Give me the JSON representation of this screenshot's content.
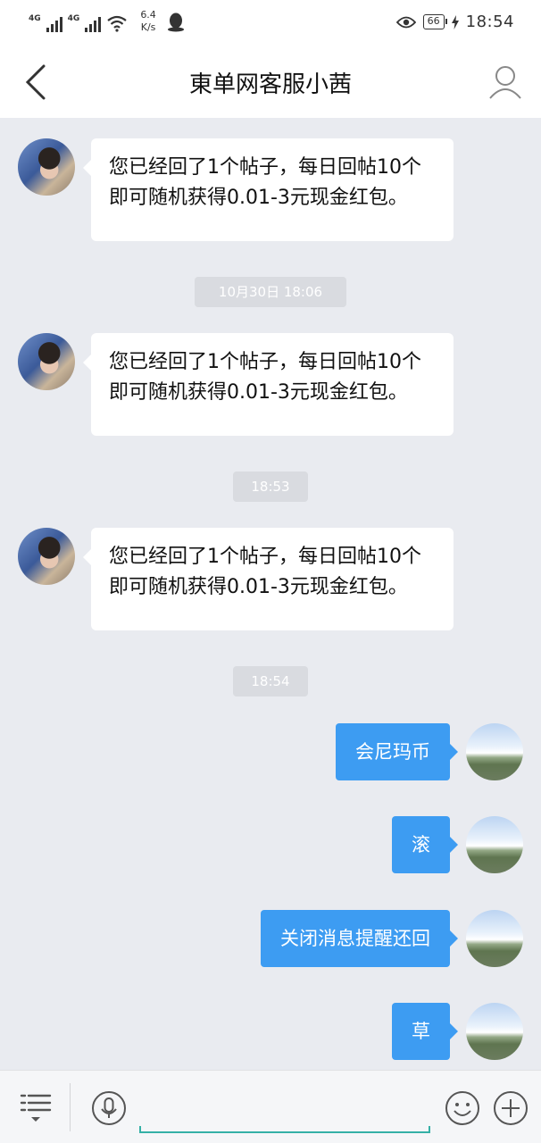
{
  "status_bar": {
    "net1": "4G",
    "net2": "4G",
    "speed_value": "6.4",
    "speed_unit": "K/s",
    "battery": "66",
    "time": "18:54"
  },
  "header": {
    "title": "東单网客服小茜",
    "back_icon": "chevron-left-icon",
    "profile_icon": "user-icon"
  },
  "messages": [
    {
      "side": "left",
      "text": "您已经回了1个帖子，每日回帖10个即可随机获得0.01-3元现金红包。"
    },
    {
      "side": "time",
      "text": "10月30日 18:06"
    },
    {
      "side": "left",
      "text": "您已经回了1个帖子，每日回帖10个即可随机获得0.01-3元现金红包。"
    },
    {
      "side": "time",
      "text": "18:53"
    },
    {
      "side": "left",
      "text": "您已经回了1个帖子，每日回帖10个即可随机获得0.01-3元现金红包。"
    },
    {
      "side": "time",
      "text": "18:54"
    },
    {
      "side": "right",
      "text": "会尼玛币"
    },
    {
      "side": "right",
      "text": "滚"
    },
    {
      "side": "right",
      "text": "关闭消息提醒还回"
    },
    {
      "side": "right",
      "text": "草"
    }
  ],
  "input_bar": {
    "menu_icon": "menu-icon",
    "mic_icon": "microphone-icon",
    "input_value": "",
    "emoji_icon": "smiley-icon",
    "plus_icon": "plus-circle-icon"
  },
  "colors": {
    "background": "#e9ebf0",
    "bubble_right": "#3d9cf2",
    "bubble_left": "#ffffff",
    "input_underline": "#35b0a6"
  }
}
